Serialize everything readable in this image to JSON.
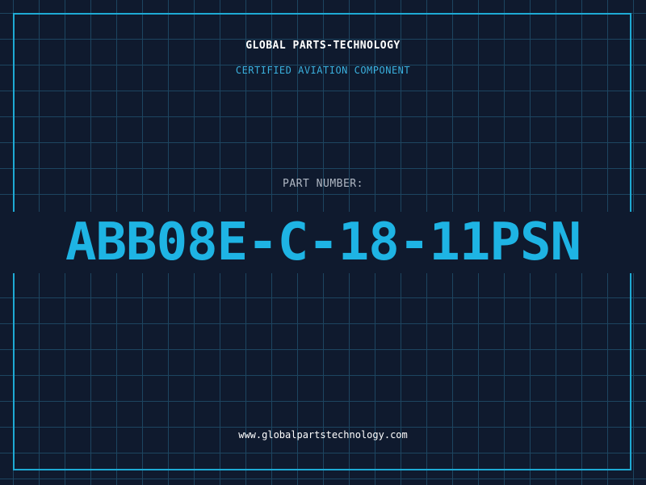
{
  "header": {
    "company": "GLOBAL PARTS-TECHNOLOGY",
    "subtitle": "CERTIFIED AVIATION COMPONENT"
  },
  "part": {
    "label": "PART NUMBER:",
    "number": "ABB08E-C-18-11PSN"
  },
  "footer": {
    "url": "www.globalpartstechnology.com"
  },
  "colors": {
    "background": "#0f1a2e",
    "grid": "#1d4560",
    "accent": "#1eb4e4",
    "label": "#b0b8c4",
    "text": "#ffffff"
  }
}
